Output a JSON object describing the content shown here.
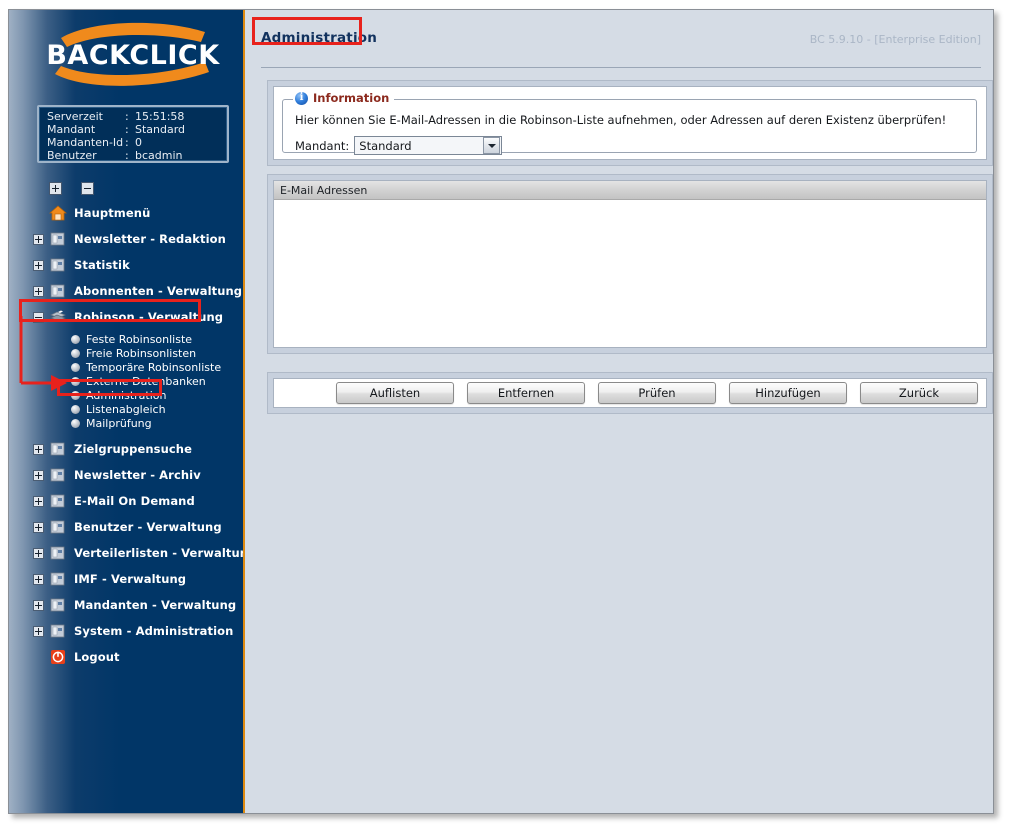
{
  "brand": {
    "name": "BACKCLICK"
  },
  "server_info": {
    "rows": [
      {
        "key": "Serverzeit",
        "colon": ":",
        "value": "15:51:58"
      },
      {
        "key": "Mandant",
        "colon": ":",
        "value": "Standard"
      },
      {
        "key": "Mandanten-Id",
        "colon": ":",
        "value": "0"
      },
      {
        "key": "Benutzer",
        "colon": ":",
        "value": "bcadmin"
      }
    ]
  },
  "tree_controls": {
    "expand_all": "expand-all-icon",
    "collapse_all": "collapse-all-icon"
  },
  "sidebar": {
    "items": [
      {
        "label": "Hauptmenü",
        "icon": "home-icon",
        "expander": "none",
        "highlight": false
      },
      {
        "label": "Newsletter - Redaktion",
        "icon": "folder-icon",
        "expander": "plus",
        "highlight": false
      },
      {
        "label": "Statistik",
        "icon": "folder-icon",
        "expander": "plus",
        "highlight": false
      },
      {
        "label": "Abonnenten - Verwaltung",
        "icon": "folder-icon",
        "expander": "plus",
        "highlight": false
      },
      {
        "label": "Robinson - Verwaltung",
        "icon": "robinson-icon",
        "expander": "minus",
        "highlight": true
      },
      {
        "label": "Zielgruppensuche",
        "icon": "folder-icon",
        "expander": "plus",
        "highlight": false
      },
      {
        "label": "Newsletter - Archiv",
        "icon": "folder-icon",
        "expander": "plus",
        "highlight": false
      },
      {
        "label": "E-Mail On Demand",
        "icon": "folder-icon",
        "expander": "plus",
        "highlight": false
      },
      {
        "label": "Benutzer - Verwaltung",
        "icon": "folder-icon",
        "expander": "plus",
        "highlight": false
      },
      {
        "label": "Verteilerlisten - Verwaltung",
        "icon": "folder-icon",
        "expander": "plus",
        "highlight": false
      },
      {
        "label": "IMF - Verwaltung",
        "icon": "folder-icon",
        "expander": "plus",
        "highlight": false
      },
      {
        "label": "Mandanten - Verwaltung",
        "icon": "folder-icon",
        "expander": "plus",
        "highlight": false
      },
      {
        "label": "System - Administration",
        "icon": "folder-icon",
        "expander": "plus",
        "highlight": false
      },
      {
        "label": "Logout",
        "icon": "logout-icon",
        "expander": "none",
        "highlight": false
      }
    ],
    "robinson_children": [
      {
        "label": "Feste Robinsonliste",
        "selected": false
      },
      {
        "label": "Freie Robinsonlisten",
        "selected": false
      },
      {
        "label": "Temporäre Robinsonliste",
        "selected": false
      },
      {
        "label": "Externe Datenbanken",
        "selected": false
      },
      {
        "label": "Administration",
        "selected": true
      },
      {
        "label": "Listenabgleich",
        "selected": false
      },
      {
        "label": "Mailprüfung",
        "selected": false
      }
    ]
  },
  "header": {
    "title": "Administration",
    "version": "BC 5.9.10 - [Enterprise Edition]"
  },
  "information": {
    "legend": "Information",
    "text": "Hier können Sie E-Mail-Adressen in die Robinson-Liste aufnehmen, oder Adressen auf deren Existenz überprüfen!",
    "mandant_label": "Mandant:",
    "mandant_value": "Standard",
    "mandant_options": [
      "Standard"
    ]
  },
  "address_list": {
    "header": "E-Mail Adressen",
    "rows": []
  },
  "buttons": [
    {
      "label": "Auflisten"
    },
    {
      "label": "Entfernen"
    },
    {
      "label": "Prüfen"
    },
    {
      "label": "Hinzufügen"
    },
    {
      "label": "Zurück"
    }
  ],
  "annotations": {
    "accent_color": "#e8221c",
    "boxes": [
      "title-administration",
      "sidebar-robinson-verwaltung",
      "sidebar-administration"
    ]
  }
}
